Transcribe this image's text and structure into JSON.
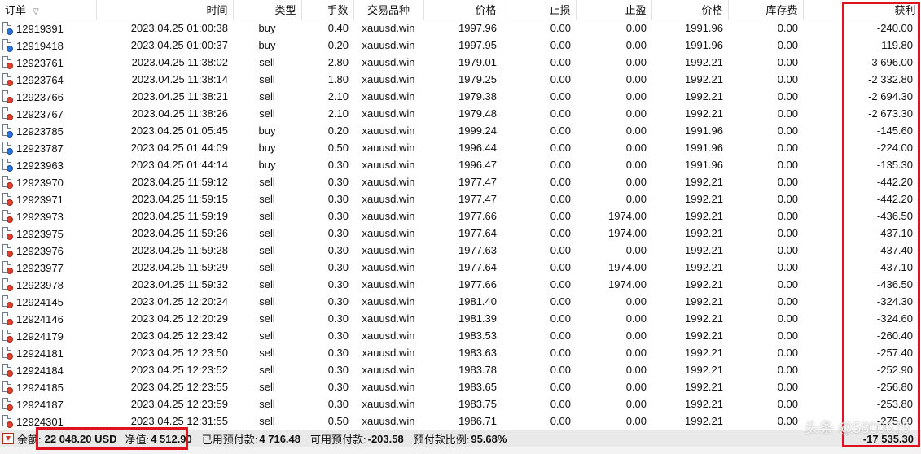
{
  "columns": [
    "订单",
    "时间",
    "类型",
    "手数",
    "交易品种",
    "价格",
    "止损",
    "止盈",
    "价格",
    "库存费",
    "获利"
  ],
  "rows": [
    {
      "order": "12919391",
      "time": "2023.04.25 01:00:38",
      "type": "buy",
      "lots": "0.40",
      "symbol": "xauusd.win",
      "price_open": "1997.96",
      "sl": "0.00",
      "tp": "0.00",
      "price_current": "1991.96",
      "swap": "0.00",
      "profit": "-240.00"
    },
    {
      "order": "12919418",
      "time": "2023.04.25 01:00:37",
      "type": "buy",
      "lots": "0.20",
      "symbol": "xauusd.win",
      "price_open": "1997.95",
      "sl": "0.00",
      "tp": "0.00",
      "price_current": "1991.96",
      "swap": "0.00",
      "profit": "-119.80"
    },
    {
      "order": "12923761",
      "time": "2023.04.25 11:38:02",
      "type": "sell",
      "lots": "2.80",
      "symbol": "xauusd.win",
      "price_open": "1979.01",
      "sl": "0.00",
      "tp": "0.00",
      "price_current": "1992.21",
      "swap": "0.00",
      "profit": "-3 696.00"
    },
    {
      "order": "12923764",
      "time": "2023.04.25 11:38:14",
      "type": "sell",
      "lots": "1.80",
      "symbol": "xauusd.win",
      "price_open": "1979.25",
      "sl": "0.00",
      "tp": "0.00",
      "price_current": "1992.21",
      "swap": "0.00",
      "profit": "-2 332.80"
    },
    {
      "order": "12923766",
      "time": "2023.04.25 11:38:21",
      "type": "sell",
      "lots": "2.10",
      "symbol": "xauusd.win",
      "price_open": "1979.38",
      "sl": "0.00",
      "tp": "0.00",
      "price_current": "1992.21",
      "swap": "0.00",
      "profit": "-2 694.30"
    },
    {
      "order": "12923767",
      "time": "2023.04.25 11:38:26",
      "type": "sell",
      "lots": "2.10",
      "symbol": "xauusd.win",
      "price_open": "1979.48",
      "sl": "0.00",
      "tp": "0.00",
      "price_current": "1992.21",
      "swap": "0.00",
      "profit": "-2 673.30"
    },
    {
      "order": "12923785",
      "time": "2023.04.25 01:05:45",
      "type": "buy",
      "lots": "0.20",
      "symbol": "xauusd.win",
      "price_open": "1999.24",
      "sl": "0.00",
      "tp": "0.00",
      "price_current": "1991.96",
      "swap": "0.00",
      "profit": "-145.60"
    },
    {
      "order": "12923787",
      "time": "2023.04.25 01:44:09",
      "type": "buy",
      "lots": "0.50",
      "symbol": "xauusd.win",
      "price_open": "1996.44",
      "sl": "0.00",
      "tp": "0.00",
      "price_current": "1991.96",
      "swap": "0.00",
      "profit": "-224.00"
    },
    {
      "order": "12923963",
      "time": "2023.04.25 01:44:14",
      "type": "buy",
      "lots": "0.30",
      "symbol": "xauusd.win",
      "price_open": "1996.47",
      "sl": "0.00",
      "tp": "0.00",
      "price_current": "1991.96",
      "swap": "0.00",
      "profit": "-135.30"
    },
    {
      "order": "12923970",
      "time": "2023.04.25 11:59:12",
      "type": "sell",
      "lots": "0.30",
      "symbol": "xauusd.win",
      "price_open": "1977.47",
      "sl": "0.00",
      "tp": "0.00",
      "price_current": "1992.21",
      "swap": "0.00",
      "profit": "-442.20"
    },
    {
      "order": "12923971",
      "time": "2023.04.25 11:59:15",
      "type": "sell",
      "lots": "0.30",
      "symbol": "xauusd.win",
      "price_open": "1977.47",
      "sl": "0.00",
      "tp": "0.00",
      "price_current": "1992.21",
      "swap": "0.00",
      "profit": "-442.20"
    },
    {
      "order": "12923973",
      "time": "2023.04.25 11:59:19",
      "type": "sell",
      "lots": "0.30",
      "symbol": "xauusd.win",
      "price_open": "1977.66",
      "sl": "0.00",
      "tp": "1974.00",
      "price_current": "1992.21",
      "swap": "0.00",
      "profit": "-436.50"
    },
    {
      "order": "12923975",
      "time": "2023.04.25 11:59:26",
      "type": "sell",
      "lots": "0.30",
      "symbol": "xauusd.win",
      "price_open": "1977.64",
      "sl": "0.00",
      "tp": "1974.00",
      "price_current": "1992.21",
      "swap": "0.00",
      "profit": "-437.10"
    },
    {
      "order": "12923976",
      "time": "2023.04.25 11:59:28",
      "type": "sell",
      "lots": "0.30",
      "symbol": "xauusd.win",
      "price_open": "1977.63",
      "sl": "0.00",
      "tp": "0.00",
      "price_current": "1992.21",
      "swap": "0.00",
      "profit": "-437.40"
    },
    {
      "order": "12923977",
      "time": "2023.04.25 11:59:29",
      "type": "sell",
      "lots": "0.30",
      "symbol": "xauusd.win",
      "price_open": "1977.64",
      "sl": "0.00",
      "tp": "1974.00",
      "price_current": "1992.21",
      "swap": "0.00",
      "profit": "-437.10"
    },
    {
      "order": "12923978",
      "time": "2023.04.25 11:59:32",
      "type": "sell",
      "lots": "0.30",
      "symbol": "xauusd.win",
      "price_open": "1977.66",
      "sl": "0.00",
      "tp": "1974.00",
      "price_current": "1992.21",
      "swap": "0.00",
      "profit": "-436.50"
    },
    {
      "order": "12924145",
      "time": "2023.04.25 12:20:24",
      "type": "sell",
      "lots": "0.30",
      "symbol": "xauusd.win",
      "price_open": "1981.40",
      "sl": "0.00",
      "tp": "0.00",
      "price_current": "1992.21",
      "swap": "0.00",
      "profit": "-324.30"
    },
    {
      "order": "12924146",
      "time": "2023.04.25 12:20:29",
      "type": "sell",
      "lots": "0.30",
      "symbol": "xauusd.win",
      "price_open": "1981.39",
      "sl": "0.00",
      "tp": "0.00",
      "price_current": "1992.21",
      "swap": "0.00",
      "profit": "-324.60"
    },
    {
      "order": "12924179",
      "time": "2023.04.25 12:23:42",
      "type": "sell",
      "lots": "0.30",
      "symbol": "xauusd.win",
      "price_open": "1983.53",
      "sl": "0.00",
      "tp": "0.00",
      "price_current": "1992.21",
      "swap": "0.00",
      "profit": "-260.40"
    },
    {
      "order": "12924181",
      "time": "2023.04.25 12:23:50",
      "type": "sell",
      "lots": "0.30",
      "symbol": "xauusd.win",
      "price_open": "1983.63",
      "sl": "0.00",
      "tp": "0.00",
      "price_current": "1992.21",
      "swap": "0.00",
      "profit": "-257.40"
    },
    {
      "order": "12924184",
      "time": "2023.04.25 12:23:52",
      "type": "sell",
      "lots": "0.30",
      "symbol": "xauusd.win",
      "price_open": "1983.78",
      "sl": "0.00",
      "tp": "0.00",
      "price_current": "1992.21",
      "swap": "0.00",
      "profit": "-252.90"
    },
    {
      "order": "12924185",
      "time": "2023.04.25 12:23:55",
      "type": "sell",
      "lots": "0.30",
      "symbol": "xauusd.win",
      "price_open": "1983.65",
      "sl": "0.00",
      "tp": "0.00",
      "price_current": "1992.21",
      "swap": "0.00",
      "profit": "-256.80"
    },
    {
      "order": "12924187",
      "time": "2023.04.25 12:23:59",
      "type": "sell",
      "lots": "0.30",
      "symbol": "xauusd.win",
      "price_open": "1983.75",
      "sl": "0.00",
      "tp": "0.00",
      "price_current": "1992.21",
      "swap": "0.00",
      "profit": "-253.80"
    },
    {
      "order": "12924301",
      "time": "2023.04.25 12:31:55",
      "type": "sell",
      "lots": "0.50",
      "symbol": "xauusd.win",
      "price_open": "1986.71",
      "sl": "0.00",
      "tp": "0.00",
      "price_current": "1992.21",
      "swap": "0.00",
      "profit": "-275.00"
    }
  ],
  "status": {
    "balance_label": "余额:",
    "balance_value": "22 048.20 USD",
    "equity_label": "净值:",
    "equity_value": "4 512.90",
    "margin_label": "已用预付款:",
    "margin_value": "4 716.48",
    "free_margin_label": "可用预付款:",
    "free_margin_value": "-203.58",
    "margin_level_label": "预付款比例:",
    "margin_level_value": "95.68%",
    "total_profit": "-17 535.30"
  },
  "watermark": "头条 @5800675",
  "colors": {
    "highlight": "#e0121f",
    "buy_icon": "#2a73d9",
    "sell_icon": "#e0402f"
  }
}
